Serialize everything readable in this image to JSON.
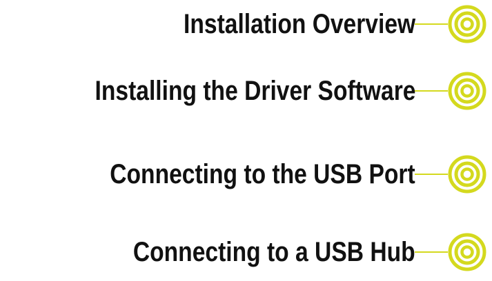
{
  "menu": {
    "accent_color": "#d4d91e",
    "icon": "target-icon",
    "items": [
      {
        "label": "Installation Overview"
      },
      {
        "label": "Installing the Driver Software"
      },
      {
        "label": "Connecting to the USB Port"
      },
      {
        "label": "Connecting to a USB Hub"
      }
    ]
  }
}
